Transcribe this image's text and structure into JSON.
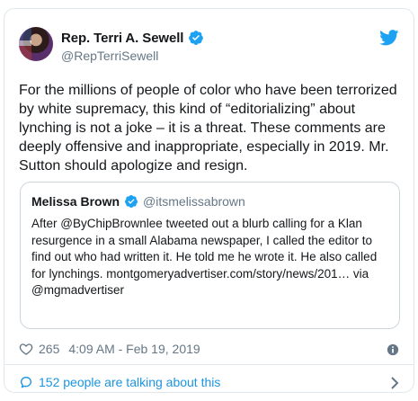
{
  "tweet": {
    "author_name": "Rep. Terri A. Sewell",
    "author_handle": "@RepTerriSewell",
    "text": "For the millions of people of color who have been terrorized by white supremacy, this kind of “editorializing” about lynching is not a joke – it is a threat. These comments are deeply offensive and inappropriate, especially in 2019.  Mr. Sutton should apologize and resign.",
    "likes": "265",
    "timestamp": "4:09 AM - Feb 19, 2019"
  },
  "quoted_tweet": {
    "author_name": "Melissa Brown",
    "author_handle": "@itsmelissabrown",
    "text": "After @ByChipBrownlee tweeted out a blurb calling for a Klan resurgence in a small Alabama newspaper, I called the editor to find out who had written it. He told me he wrote it. He also called for lynchings. montgomeryadvertiser.com/story/news/201… via @mgmadvertiser"
  },
  "footer": {
    "talking_label": "152 people are talking about this"
  },
  "icons": {
    "brand": "twitter-bird-icon",
    "verified": "verified-badge-icon",
    "like": "heart-icon",
    "info": "info-icon",
    "conversation": "speech-bubble-icon",
    "more": "chevron-right-icon"
  },
  "colors": {
    "twitter_blue": "#1da1f2",
    "link_blue": "#1b95e0",
    "secondary_text": "#657786",
    "border": "#e1e8ed"
  }
}
